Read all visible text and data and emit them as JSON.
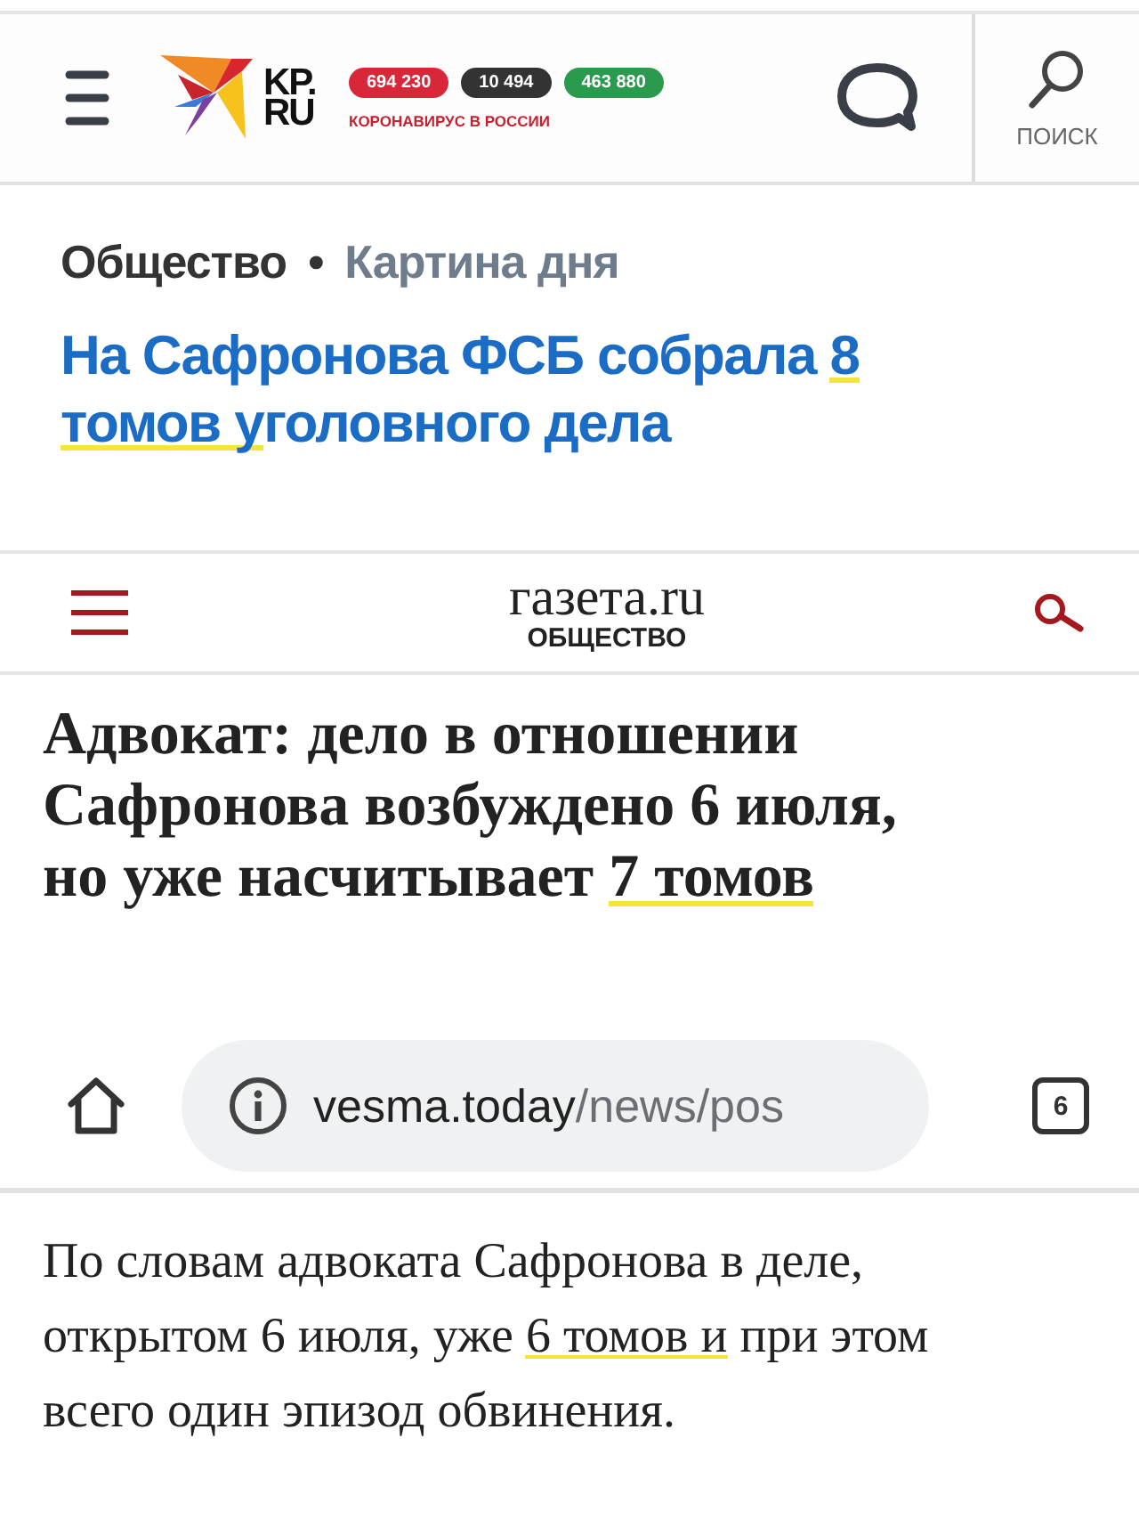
{
  "kp_header": {
    "logo_text": [
      "KP.",
      "RU"
    ],
    "counters": [
      {
        "value": "694 230",
        "color": "#d9273a"
      },
      {
        "value": "10 494",
        "color": "#333333"
      },
      {
        "value": "463 880",
        "color": "#2a9a4e"
      }
    ],
    "covid_link": "КОРОНАВИРУС В РОССИИ",
    "search_label": "ПОИСК"
  },
  "kp_article": {
    "breadcrumbs": [
      {
        "label": "Общество",
        "kind": "section"
      },
      {
        "label": "•",
        "kind": "separator"
      },
      {
        "label": "Картина дня",
        "kind": "rubric"
      }
    ],
    "headline": [
      {
        "text": "На Сафронова ФСБ собрала ",
        "highlighted": false
      },
      {
        "text": "8 томов у",
        "highlighted": true
      },
      {
        "text": "головного дела",
        "highlighted": false
      }
    ]
  },
  "gazeta_header": {
    "logo": "газета.ru",
    "section": "ОБЩЕСТВО"
  },
  "gazeta_article": {
    "headline": [
      {
        "text": "Адвокат: дело в отношении Сафронова возбуждено 6 июля, но уже насчитывает ",
        "highlighted": false
      },
      {
        "text": "7 томов",
        "highlighted": true
      }
    ]
  },
  "browser": {
    "url_host": "vesma.today",
    "url_path": "/news/pos",
    "tab_count": "6"
  },
  "vesma_article": {
    "paragraph": [
      {
        "text": "По словам адвоката Сафронова в деле, открытом 6 июля, уже ",
        "highlighted": false
      },
      {
        "text": "6 томов и",
        "highlighted": true
      },
      {
        "text": " при этом всего один эпизод обвинения.",
        "highlighted": false
      }
    ]
  }
}
